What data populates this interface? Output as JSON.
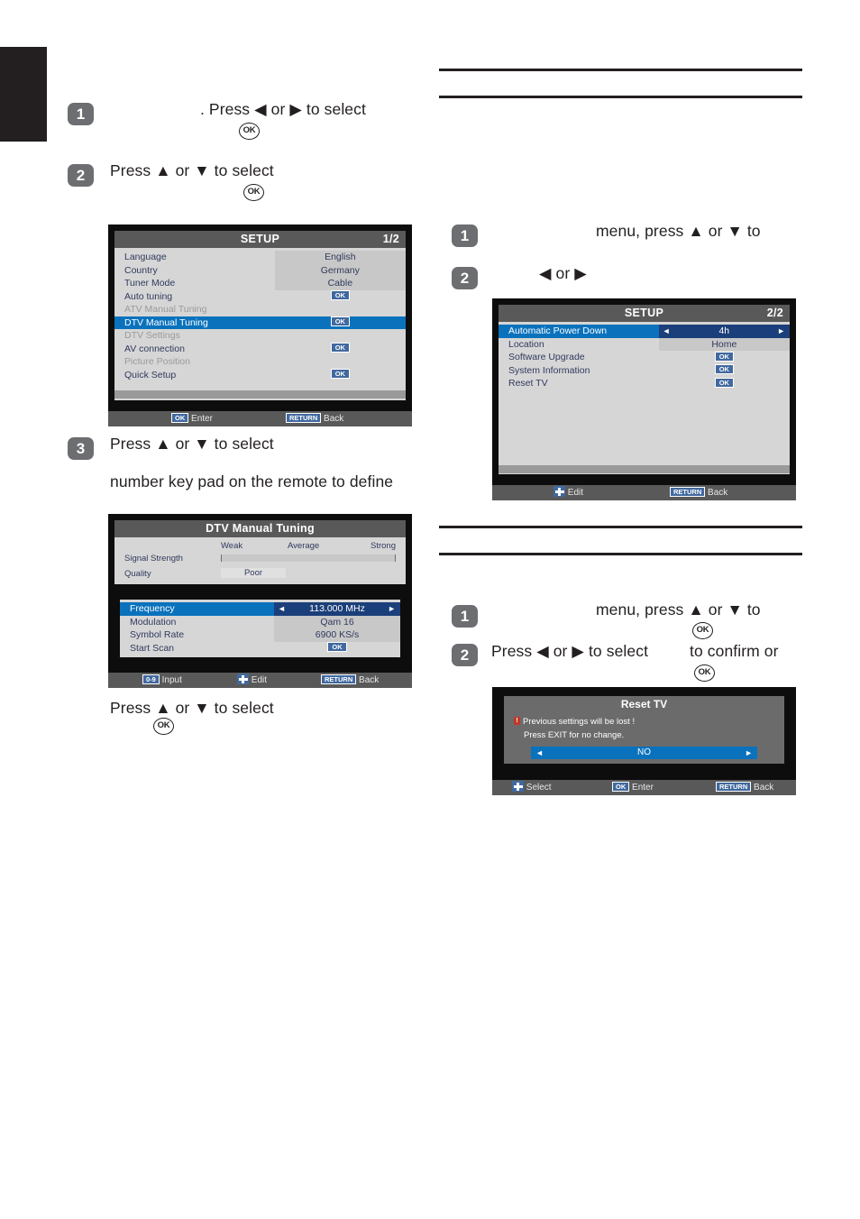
{
  "page": {
    "edge_tab": "black-chapter-tab"
  },
  "left_column": {
    "steps": [
      {
        "num": "1",
        "text": ". Press ◀ or ▶ to select",
        "ok_glyph": "OK"
      },
      {
        "num": "2",
        "text": "Press ▲ or ▼ to select",
        "ok_glyph": "OK"
      },
      {
        "num": "3",
        "text": "Press ▲ or ▼ to select",
        "text2": "number key pad on the remote to define"
      }
    ],
    "trailing_text": "Press ▲ or ▼ to select",
    "trailing_ok": "OK"
  },
  "right_column": {
    "rules": [
      "rule-1",
      "rule-2",
      "rule-3",
      "rule-4"
    ],
    "block_a": {
      "steps": [
        {
          "num": "1",
          "text": "menu, press ▲ or ▼ to"
        },
        {
          "num": "2",
          "text": "◀ or ▶"
        }
      ]
    },
    "block_b": {
      "steps": [
        {
          "num": "1",
          "text": "menu, press ▲ or ▼ to",
          "ok_glyph": "OK"
        },
        {
          "num": "2",
          "text_before": "Press ◀ or ▶ to select",
          "text_after": "to confirm or",
          "ok_glyph": "OK"
        }
      ]
    }
  },
  "setup_menu_1": {
    "title": "SETUP",
    "page_indicator": "1/2",
    "rows": [
      {
        "label": "Language",
        "value": "English",
        "state": "shade"
      },
      {
        "label": "Country",
        "value": "Germany",
        "state": "shade"
      },
      {
        "label": "Tuner Mode",
        "value": "Cable",
        "state": "shade"
      },
      {
        "label": "Auto tuning",
        "value": "OK",
        "state": "ok"
      },
      {
        "label": "ATV Manual Tuning",
        "value": "",
        "state": "dim"
      },
      {
        "label": "DTV Manual Tuning",
        "value": "OK",
        "state": "selected-ok"
      },
      {
        "label": "DTV Settings",
        "value": "",
        "state": "dim"
      },
      {
        "label": "AV connection",
        "value": "OK",
        "state": "ok"
      },
      {
        "label": "Picture Position",
        "value": "",
        "state": "dim"
      },
      {
        "label": "Quick Setup",
        "value": "OK",
        "state": "ok"
      }
    ],
    "bottom_bar": [
      {
        "key": "OK",
        "label": "Enter"
      },
      {
        "key": "RETURN",
        "label": "Back"
      }
    ]
  },
  "dtv_manual_tuning": {
    "title": "DTV Manual Tuning",
    "scale": {
      "weak": "Weak",
      "average": "Average",
      "strong": "Strong"
    },
    "signal_strength_label": "Signal Strength",
    "signal_strength_value": 0,
    "quality_label": "Quality",
    "quality_value": "Poor",
    "rows": [
      {
        "label": "Frequency",
        "value": "113.000 MHz",
        "state": "selected-arrows"
      },
      {
        "label": "Modulation",
        "value": "Qam 16",
        "state": "shade"
      },
      {
        "label": "Symbol Rate",
        "value": "6900 KS/s",
        "state": "shade"
      },
      {
        "label": "Start Scan",
        "value": "OK",
        "state": "ok"
      }
    ],
    "bottom_bar": [
      {
        "key": "0-9",
        "label": "Input"
      },
      {
        "key": "dpad",
        "label": "Edit"
      },
      {
        "key": "RETURN",
        "label": "Back"
      }
    ]
  },
  "setup_menu_2": {
    "title": "SETUP",
    "page_indicator": "2/2",
    "rows": [
      {
        "label": "Automatic Power Down",
        "value": "4h",
        "state": "selected-arrows"
      },
      {
        "label": "Location",
        "value": "Home",
        "state": "shade"
      },
      {
        "label": "Software Upgrade",
        "value": "OK",
        "state": "ok"
      },
      {
        "label": "System Information",
        "value": "OK",
        "state": "ok"
      },
      {
        "label": "Reset TV",
        "value": "OK",
        "state": "ok"
      }
    ],
    "bottom_bar": [
      {
        "key": "dpad",
        "label": "Edit"
      },
      {
        "key": "RETURN",
        "label": "Back"
      }
    ]
  },
  "reset_tv_dialog": {
    "title": "Reset TV",
    "warning_mark": "!",
    "line1": "Previous settings will be lost !",
    "line2": "Press EXIT for no change.",
    "choice": "NO",
    "bottom_bar": [
      {
        "key": "dpad",
        "label": "Select"
      },
      {
        "key": "OK",
        "label": "Enter"
      },
      {
        "key": "RETURN",
        "label": "Back"
      }
    ]
  },
  "colors": {
    "osd_frame": "#0d0d0d",
    "osd_panel": "#d6d6d6",
    "osd_header": "#595959",
    "highlight_blue": "#0a72bd",
    "value_blue": "#1b3f7a",
    "key_tag_blue": "#41699f",
    "warning_red": "#c0392b",
    "text_navy": "#303a5e",
    "ink": "#231f20"
  }
}
